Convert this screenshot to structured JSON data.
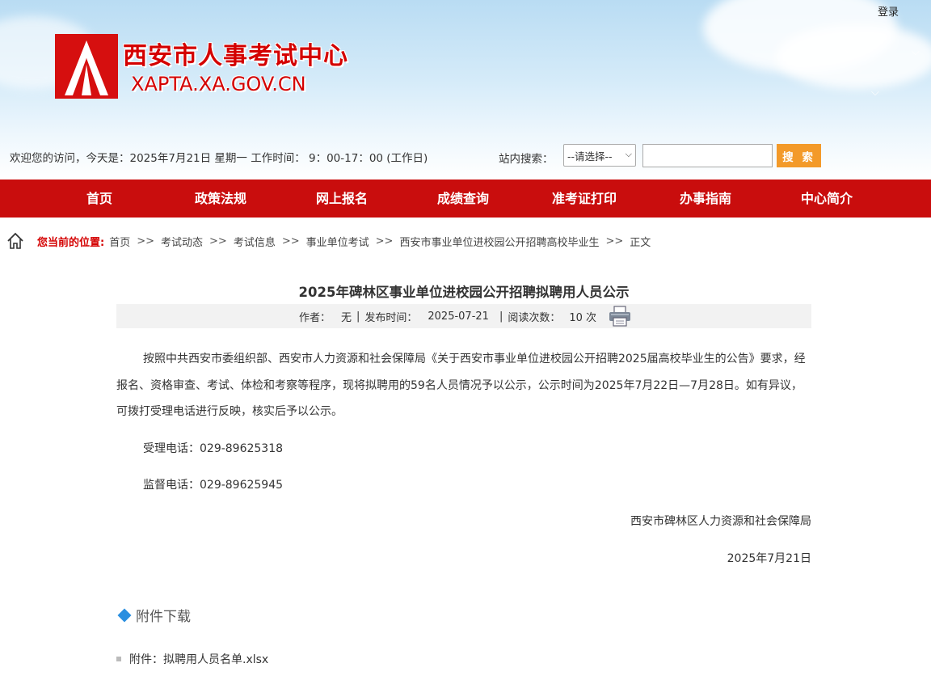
{
  "header": {
    "login": "登录",
    "site_name": "西安市人事考试中心",
    "site_url": "XAPTA.XA.GOV.CN",
    "welcome": "欢迎您的访问，今天是：2025年7月21日 星期一  工作时间： 9：00-17：00 (工作日)",
    "search_label": "站内搜索：",
    "search_select": "--请选择--",
    "search_value": "",
    "search_button": "搜 索"
  },
  "nav": [
    "首页",
    "政策法规",
    "网上报名",
    "成绩查询",
    "准考证打印",
    "办事指南",
    "中心简介"
  ],
  "breadcrumb": {
    "label": "您当前的位置:",
    "items": [
      "首页",
      "考试动态",
      "考试信息",
      "事业单位考试",
      "西安市事业单位进校园公开招聘高校毕业生",
      "正文"
    ],
    "separator": ">>"
  },
  "article": {
    "title": "2025年碑林区事业单位进校园公开招聘拟聘用人员公示",
    "author_label": "作者：",
    "author": "无",
    "date_label": "发布时间：",
    "date": "2025-07-21",
    "views_label": "阅读次数：",
    "views": "10 次",
    "paragraph": "按照中共西安市委组织部、西安市人力资源和社会保障局《关于西安市事业单位进校园公开招聘2025届高校毕业生的公告》要求，经报名、资格审查、考试、体检和考察等程序，现将拟聘用的59名人员情况予以公示，公示时间为2025年7月22日—7月28日。如有异议，可拨打受理电话进行反映，核实后予以公示。",
    "phone_accept": "受理电话：029-89625318",
    "phone_supervise": "监督电话：029-89625945",
    "signature": "西安市碑林区人力资源和社会保障局",
    "sign_date": "2025年7月21日"
  },
  "attachments": {
    "heading": "附件下载",
    "prefix": "附件：",
    "file": "拟聘用人员名单.xlsx"
  },
  "colors": {
    "brand_red": "#c90d0d",
    "search_orange": "#f39a2a",
    "accent_blue": "#2a8fe0"
  }
}
